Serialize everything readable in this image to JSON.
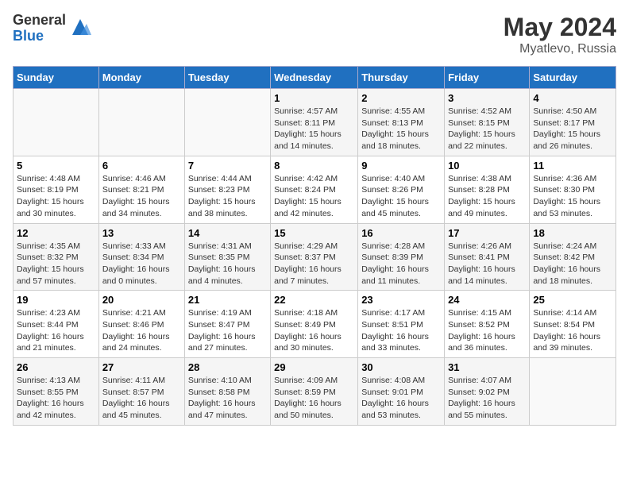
{
  "header": {
    "logo_general": "General",
    "logo_blue": "Blue",
    "month_year": "May 2024",
    "location": "Myatlevo, Russia"
  },
  "days_of_week": [
    "Sunday",
    "Monday",
    "Tuesday",
    "Wednesday",
    "Thursday",
    "Friday",
    "Saturday"
  ],
  "weeks": [
    [
      {
        "day": "",
        "sunrise": "",
        "sunset": "",
        "daylight": ""
      },
      {
        "day": "",
        "sunrise": "",
        "sunset": "",
        "daylight": ""
      },
      {
        "day": "",
        "sunrise": "",
        "sunset": "",
        "daylight": ""
      },
      {
        "day": "1",
        "sunrise": "Sunrise: 4:57 AM",
        "sunset": "Sunset: 8:11 PM",
        "daylight": "Daylight: 15 hours and 14 minutes."
      },
      {
        "day": "2",
        "sunrise": "Sunrise: 4:55 AM",
        "sunset": "Sunset: 8:13 PM",
        "daylight": "Daylight: 15 hours and 18 minutes."
      },
      {
        "day": "3",
        "sunrise": "Sunrise: 4:52 AM",
        "sunset": "Sunset: 8:15 PM",
        "daylight": "Daylight: 15 hours and 22 minutes."
      },
      {
        "day": "4",
        "sunrise": "Sunrise: 4:50 AM",
        "sunset": "Sunset: 8:17 PM",
        "daylight": "Daylight: 15 hours and 26 minutes."
      }
    ],
    [
      {
        "day": "5",
        "sunrise": "Sunrise: 4:48 AM",
        "sunset": "Sunset: 8:19 PM",
        "daylight": "Daylight: 15 hours and 30 minutes."
      },
      {
        "day": "6",
        "sunrise": "Sunrise: 4:46 AM",
        "sunset": "Sunset: 8:21 PM",
        "daylight": "Daylight: 15 hours and 34 minutes."
      },
      {
        "day": "7",
        "sunrise": "Sunrise: 4:44 AM",
        "sunset": "Sunset: 8:23 PM",
        "daylight": "Daylight: 15 hours and 38 minutes."
      },
      {
        "day": "8",
        "sunrise": "Sunrise: 4:42 AM",
        "sunset": "Sunset: 8:24 PM",
        "daylight": "Daylight: 15 hours and 42 minutes."
      },
      {
        "day": "9",
        "sunrise": "Sunrise: 4:40 AM",
        "sunset": "Sunset: 8:26 PM",
        "daylight": "Daylight: 15 hours and 45 minutes."
      },
      {
        "day": "10",
        "sunrise": "Sunrise: 4:38 AM",
        "sunset": "Sunset: 8:28 PM",
        "daylight": "Daylight: 15 hours and 49 minutes."
      },
      {
        "day": "11",
        "sunrise": "Sunrise: 4:36 AM",
        "sunset": "Sunset: 8:30 PM",
        "daylight": "Daylight: 15 hours and 53 minutes."
      }
    ],
    [
      {
        "day": "12",
        "sunrise": "Sunrise: 4:35 AM",
        "sunset": "Sunset: 8:32 PM",
        "daylight": "Daylight: 15 hours and 57 minutes."
      },
      {
        "day": "13",
        "sunrise": "Sunrise: 4:33 AM",
        "sunset": "Sunset: 8:34 PM",
        "daylight": "Daylight: 16 hours and 0 minutes."
      },
      {
        "day": "14",
        "sunrise": "Sunrise: 4:31 AM",
        "sunset": "Sunset: 8:35 PM",
        "daylight": "Daylight: 16 hours and 4 minutes."
      },
      {
        "day": "15",
        "sunrise": "Sunrise: 4:29 AM",
        "sunset": "Sunset: 8:37 PM",
        "daylight": "Daylight: 16 hours and 7 minutes."
      },
      {
        "day": "16",
        "sunrise": "Sunrise: 4:28 AM",
        "sunset": "Sunset: 8:39 PM",
        "daylight": "Daylight: 16 hours and 11 minutes."
      },
      {
        "day": "17",
        "sunrise": "Sunrise: 4:26 AM",
        "sunset": "Sunset: 8:41 PM",
        "daylight": "Daylight: 16 hours and 14 minutes."
      },
      {
        "day": "18",
        "sunrise": "Sunrise: 4:24 AM",
        "sunset": "Sunset: 8:42 PM",
        "daylight": "Daylight: 16 hours and 18 minutes."
      }
    ],
    [
      {
        "day": "19",
        "sunrise": "Sunrise: 4:23 AM",
        "sunset": "Sunset: 8:44 PM",
        "daylight": "Daylight: 16 hours and 21 minutes."
      },
      {
        "day": "20",
        "sunrise": "Sunrise: 4:21 AM",
        "sunset": "Sunset: 8:46 PM",
        "daylight": "Daylight: 16 hours and 24 minutes."
      },
      {
        "day": "21",
        "sunrise": "Sunrise: 4:19 AM",
        "sunset": "Sunset: 8:47 PM",
        "daylight": "Daylight: 16 hours and 27 minutes."
      },
      {
        "day": "22",
        "sunrise": "Sunrise: 4:18 AM",
        "sunset": "Sunset: 8:49 PM",
        "daylight": "Daylight: 16 hours and 30 minutes."
      },
      {
        "day": "23",
        "sunrise": "Sunrise: 4:17 AM",
        "sunset": "Sunset: 8:51 PM",
        "daylight": "Daylight: 16 hours and 33 minutes."
      },
      {
        "day": "24",
        "sunrise": "Sunrise: 4:15 AM",
        "sunset": "Sunset: 8:52 PM",
        "daylight": "Daylight: 16 hours and 36 minutes."
      },
      {
        "day": "25",
        "sunrise": "Sunrise: 4:14 AM",
        "sunset": "Sunset: 8:54 PM",
        "daylight": "Daylight: 16 hours and 39 minutes."
      }
    ],
    [
      {
        "day": "26",
        "sunrise": "Sunrise: 4:13 AM",
        "sunset": "Sunset: 8:55 PM",
        "daylight": "Daylight: 16 hours and 42 minutes."
      },
      {
        "day": "27",
        "sunrise": "Sunrise: 4:11 AM",
        "sunset": "Sunset: 8:57 PM",
        "daylight": "Daylight: 16 hours and 45 minutes."
      },
      {
        "day": "28",
        "sunrise": "Sunrise: 4:10 AM",
        "sunset": "Sunset: 8:58 PM",
        "daylight": "Daylight: 16 hours and 47 minutes."
      },
      {
        "day": "29",
        "sunrise": "Sunrise: 4:09 AM",
        "sunset": "Sunset: 8:59 PM",
        "daylight": "Daylight: 16 hours and 50 minutes."
      },
      {
        "day": "30",
        "sunrise": "Sunrise: 4:08 AM",
        "sunset": "Sunset: 9:01 PM",
        "daylight": "Daylight: 16 hours and 53 minutes."
      },
      {
        "day": "31",
        "sunrise": "Sunrise: 4:07 AM",
        "sunset": "Sunset: 9:02 PM",
        "daylight": "Daylight: 16 hours and 55 minutes."
      },
      {
        "day": "",
        "sunrise": "",
        "sunset": "",
        "daylight": ""
      }
    ]
  ]
}
